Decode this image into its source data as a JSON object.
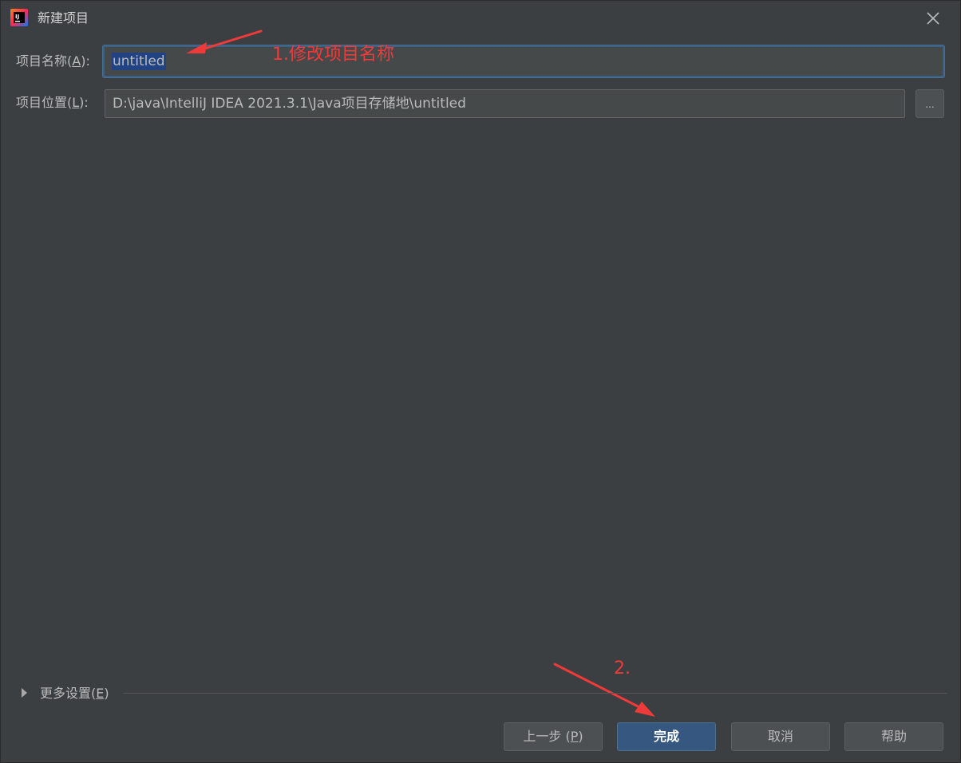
{
  "window": {
    "title": "新建项目",
    "app_icon_text": "IJ"
  },
  "form": {
    "name_label_prefix": "项目名称(",
    "name_label_mnemonic": "A",
    "name_label_suffix": "):",
    "name_value": "untitled",
    "location_label_prefix": "项目位置(",
    "location_label_mnemonic": "L",
    "location_label_suffix": "):",
    "location_value": "D:\\java\\IntelliJ IDEA 2021.3.1\\Java项目存储地\\untitled",
    "browse_label": "..."
  },
  "more_settings": {
    "label_prefix": "更多设置(",
    "label_mnemonic": "E",
    "label_suffix": ")"
  },
  "buttons": {
    "previous_prefix": "上一步 (",
    "previous_mnemonic": "P",
    "previous_suffix": ")",
    "finish": "完成",
    "cancel": "取消",
    "help": "帮助"
  },
  "annotations": {
    "step1": "1.修改项目名称",
    "step2": "2.",
    "color": "#f03a3a"
  },
  "colors": {
    "background": "#3c3f41",
    "input_background": "#45494a",
    "focus_border": "#3d6185",
    "selection": "#214283",
    "primary_button": "#365880"
  }
}
